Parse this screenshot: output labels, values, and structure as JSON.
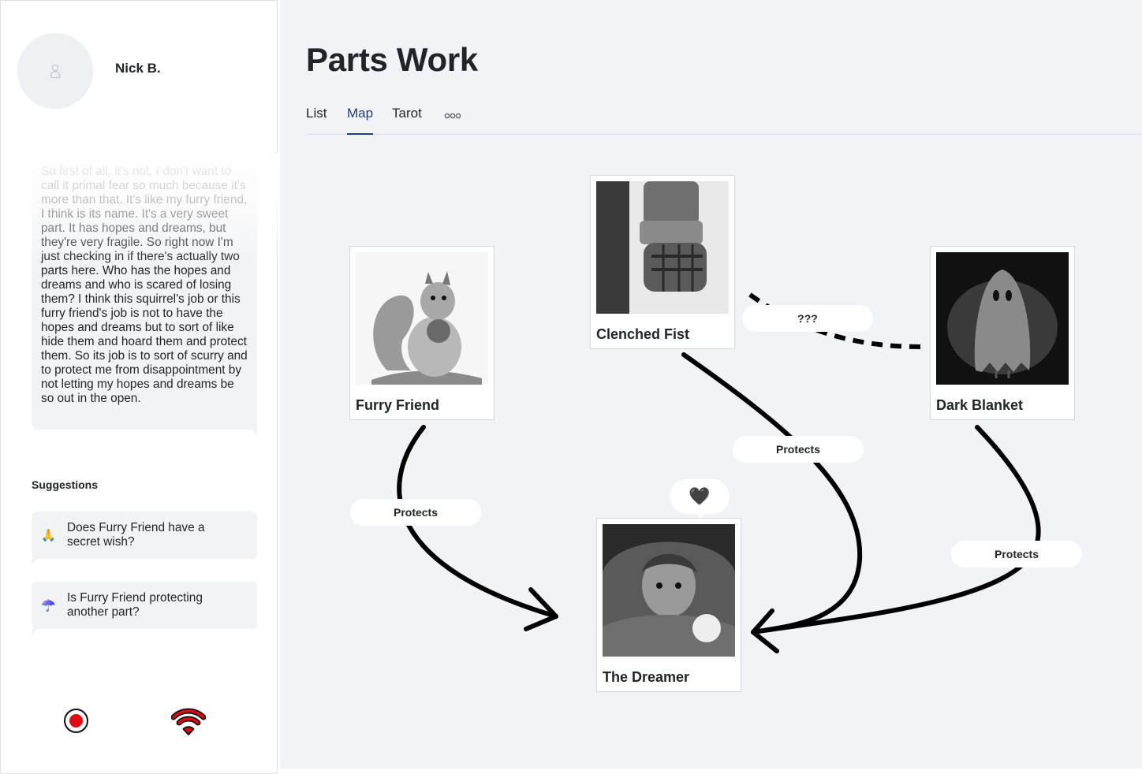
{
  "user": {
    "name": "Nick B."
  },
  "transcript": {
    "text": "So first of all, it's not, I don't want to call it primal fear so much because it's more than that. It's like my furry friend, I think is its name. It's a very sweet part. It has hopes and dreams, but they're very fragile. So right now I'm just checking in if there's actually two parts here. Who has the hopes and dreams and who is scared of losing them? I think this squirrel's job or this furry friend's job is not to have the hopes and dreams but to sort of like hide them and hoard them and protect them. So its job is to sort of scurry and to protect me from disappointment by not letting my hopes and dreams be so out in the open."
  },
  "suggestions": {
    "label": "Suggestions",
    "items": [
      {
        "emoji": "🙏",
        "text": "Does Furry Friend have a secret wish?"
      },
      {
        "emoji": "☂️",
        "text": "Is Furry Friend protecting another part?"
      }
    ]
  },
  "controls": {
    "record_icon": "record-icon",
    "signal_icon": "wifi-signal-icon",
    "record_color": "#e30613"
  },
  "page": {
    "title": "Parts Work"
  },
  "tabs": [
    {
      "label": "List",
      "active": false
    },
    {
      "label": "Map",
      "active": true
    },
    {
      "label": "Tarot",
      "active": false
    }
  ],
  "tab_more_icon": "more-dots-icon",
  "map": {
    "parts": [
      {
        "name": "Furry Friend",
        "image": "squirrel-sketch"
      },
      {
        "name": "Clenched Fist",
        "image": "armored-fist-sketch"
      },
      {
        "name": "Dark Blanket",
        "image": "ghost-sketch"
      },
      {
        "name": "The Dreamer",
        "image": "boy-under-blanket-photo"
      }
    ],
    "edges": [
      {
        "from": "Furry Friend",
        "to": "The Dreamer",
        "label": "Protects",
        "style": "solid"
      },
      {
        "from": "Clenched Fist",
        "to": "The Dreamer",
        "label": "Protects",
        "style": "solid"
      },
      {
        "from": "Dark Blanket",
        "to": "The Dreamer",
        "label": "Protects",
        "style": "solid"
      },
      {
        "from": "Dark Blanket",
        "to": "Clenched Fist",
        "label": "???",
        "style": "dashed"
      }
    ],
    "dreamer_badge": "🖤"
  },
  "colors": {
    "accent": "#1d3f7a",
    "canvas": "#f1f3f7",
    "edge": "#000000"
  }
}
